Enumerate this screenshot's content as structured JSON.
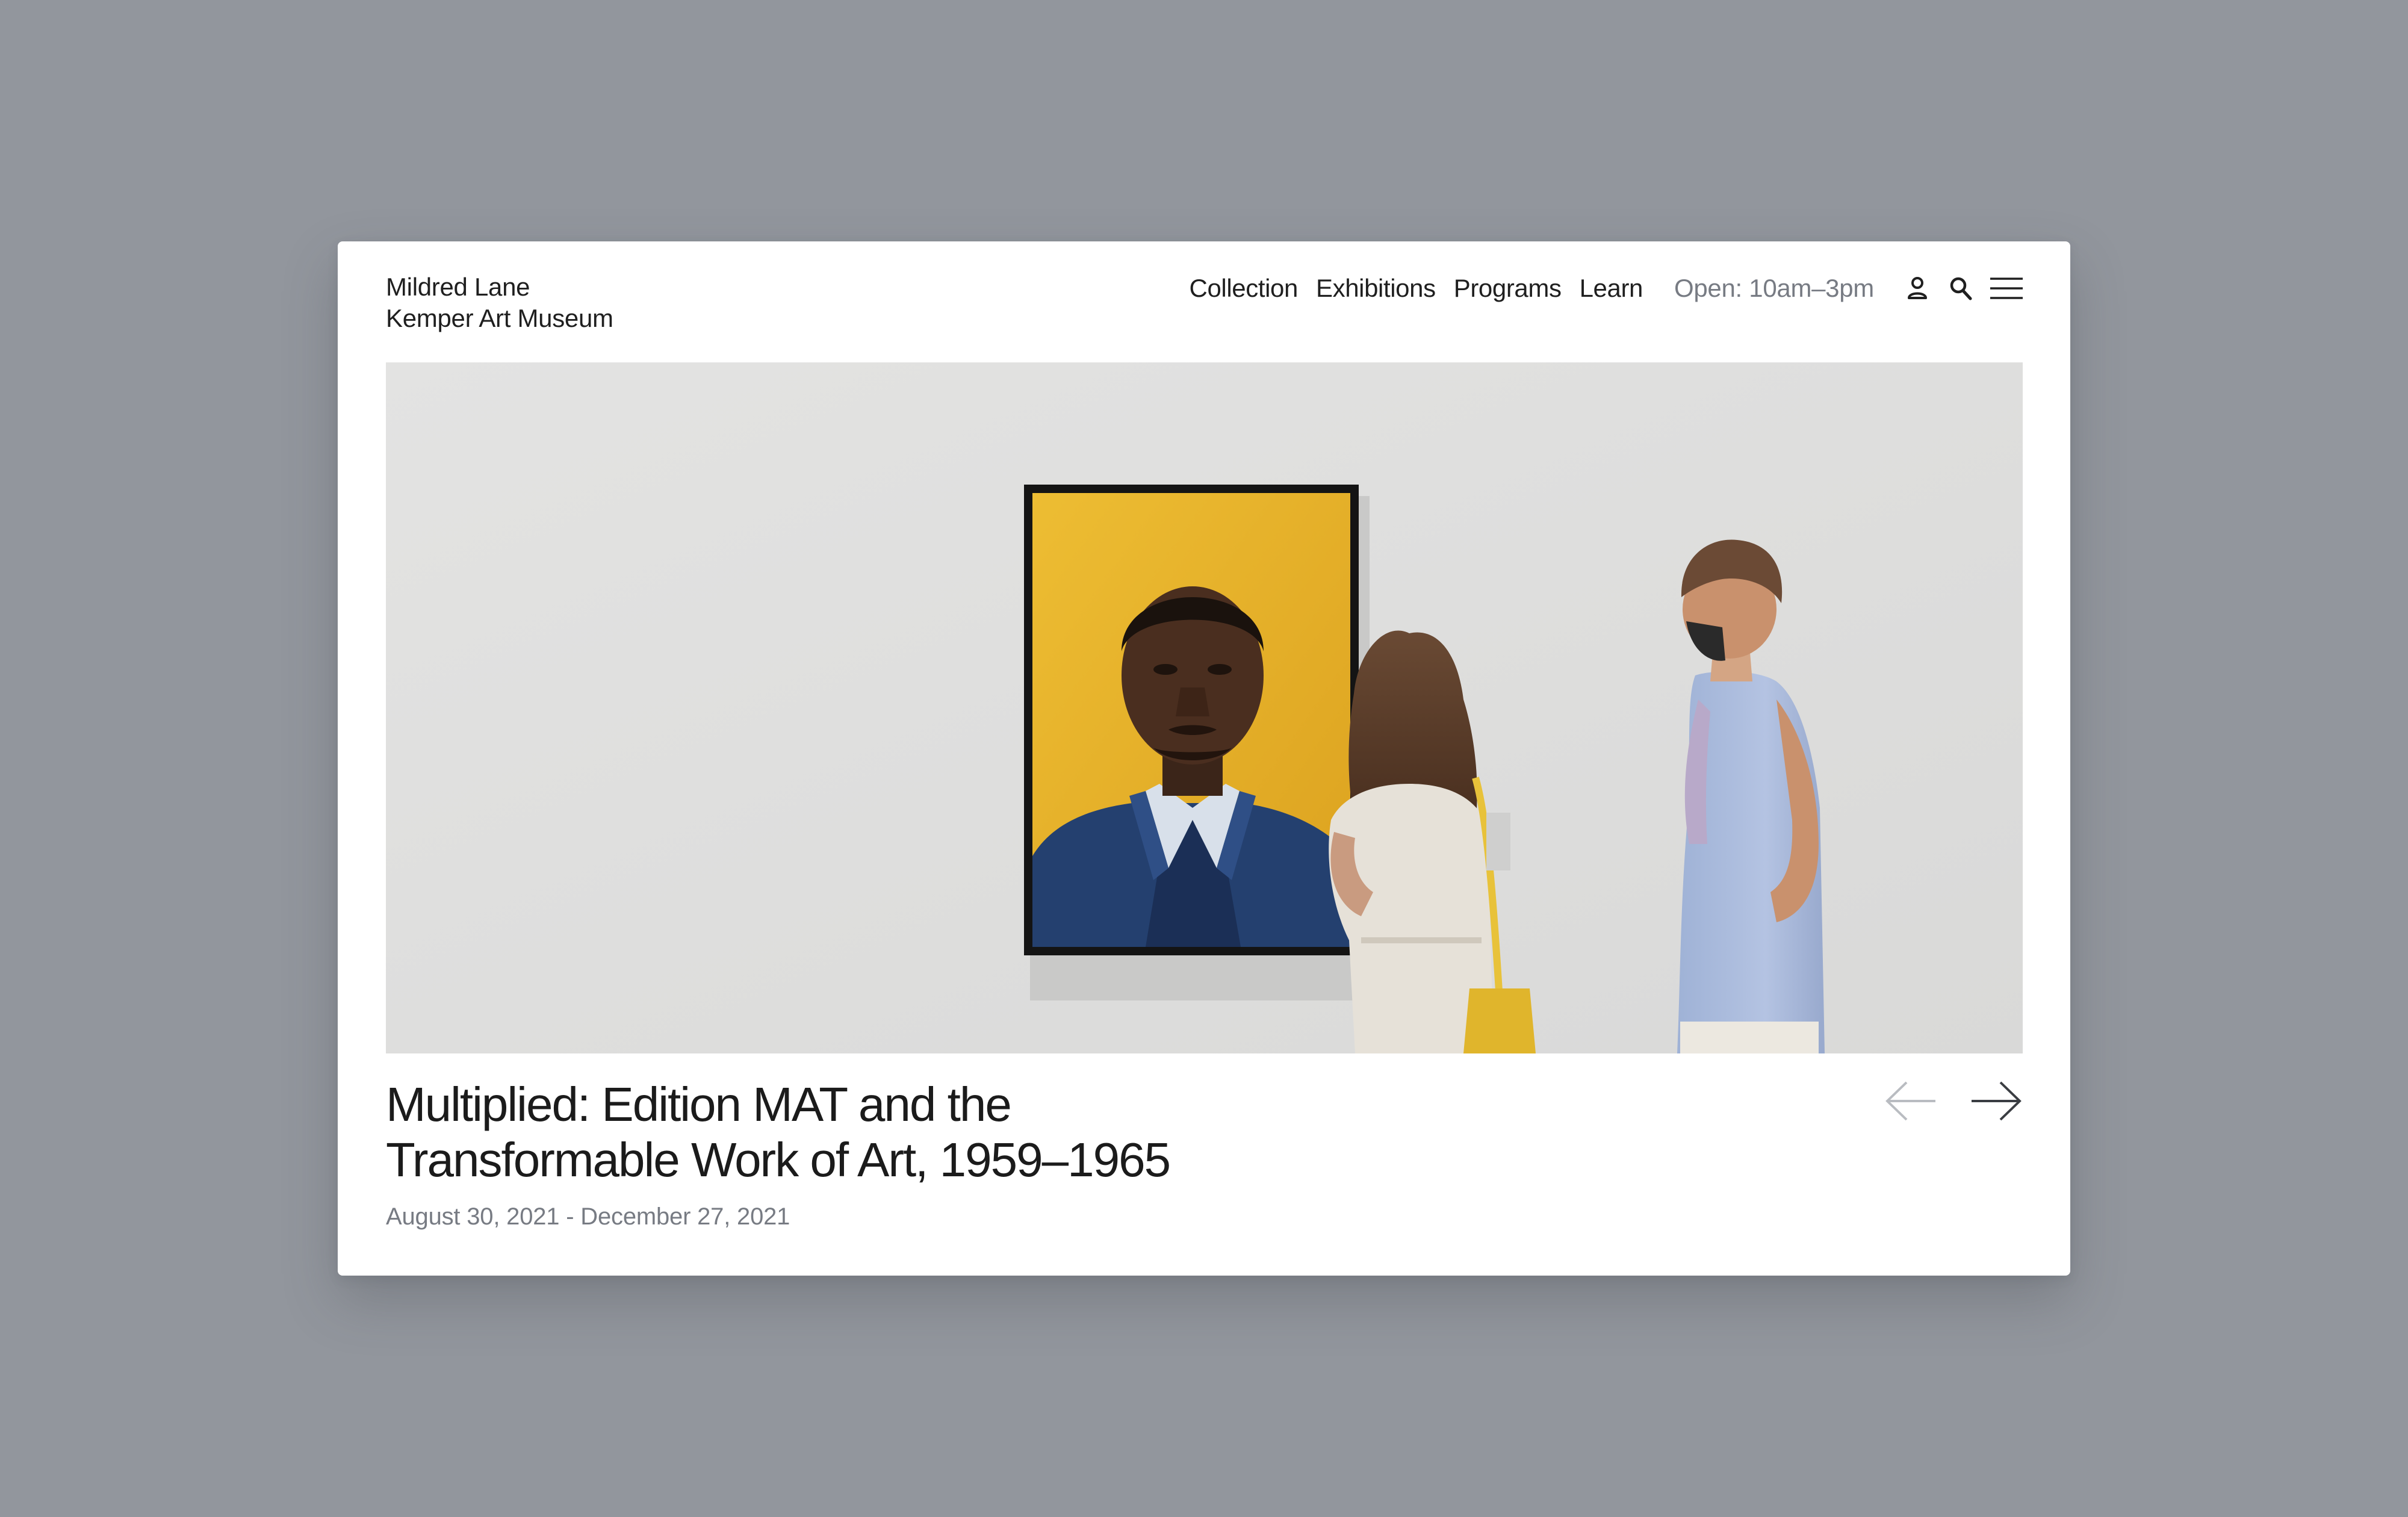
{
  "brand": {
    "line1": "Mildred Lane",
    "line2": "Kemper Art Museum"
  },
  "nav": {
    "items": [
      {
        "label": "Collection"
      },
      {
        "label": "Exhibitions"
      },
      {
        "label": "Programs"
      },
      {
        "label": "Learn"
      }
    ],
    "hours": "Open: 10am–3pm",
    "icons": [
      "user-icon",
      "search-icon",
      "menu-icon"
    ]
  },
  "hero": {
    "icon": "exhibition-photo",
    "accent_color": "#e6b326"
  },
  "exhibition": {
    "title_line1": "Multiplied: Edition MAT and the",
    "title_line2": "Transformable Work of Art, 1959–1965",
    "dates": "August 30, 2021 - December 27, 2021"
  },
  "carousel": {
    "prev_icon": "arrow-left-icon",
    "next_icon": "arrow-right-icon"
  },
  "colors": {
    "background": "#92969d",
    "card": "#ffffff",
    "text": "#1b1b1b",
    "muted": "#777b83"
  }
}
